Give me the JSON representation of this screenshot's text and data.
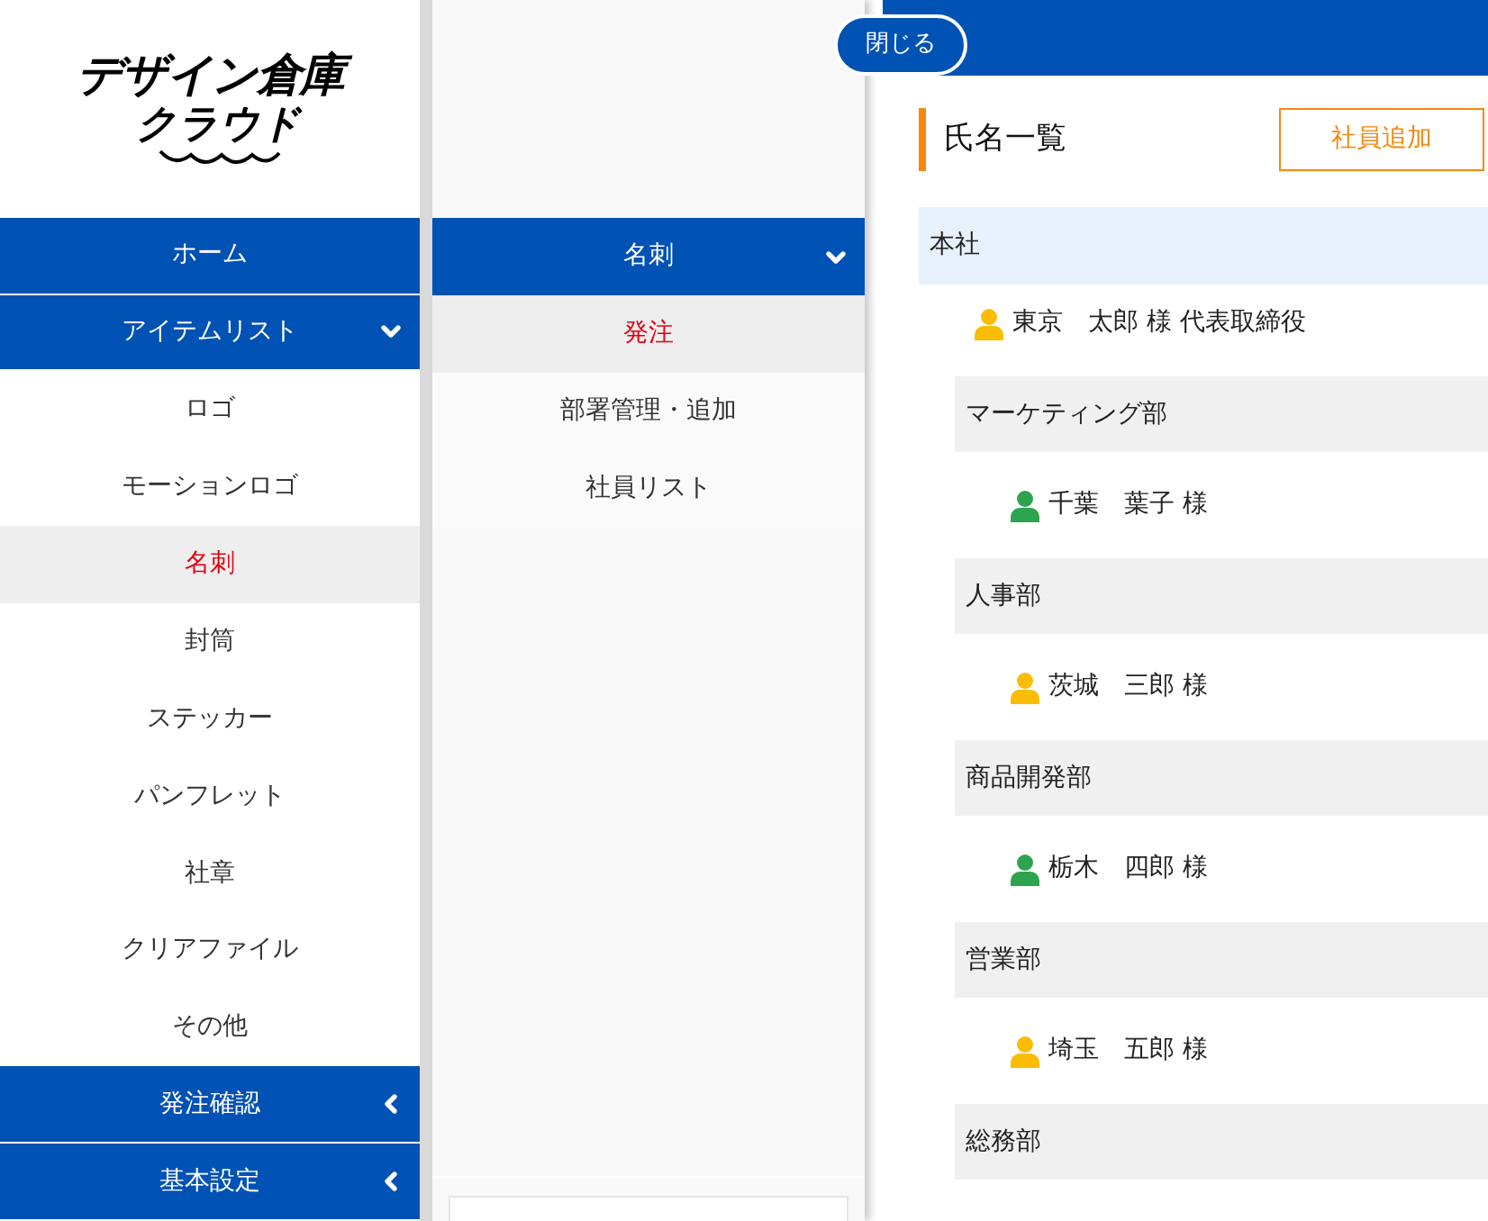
{
  "logo": {
    "line_1": "デザイン倉庫",
    "line_2": "クラウド"
  },
  "sidebar": {
    "items": [
      {
        "kind": "header",
        "label": "ホーム",
        "selected": false
      },
      {
        "kind": "header",
        "label": "アイテムリスト",
        "expanded": true,
        "selected": false
      },
      {
        "kind": "item",
        "label": "ロゴ",
        "selected": false
      },
      {
        "kind": "item",
        "label": "モーションロゴ",
        "selected": false
      },
      {
        "kind": "item",
        "label": "名刺",
        "selected": true
      },
      {
        "kind": "item",
        "label": "封筒",
        "selected": false
      },
      {
        "kind": "item",
        "label": "ステッカー",
        "selected": false
      },
      {
        "kind": "item",
        "label": "パンフレット",
        "selected": false
      },
      {
        "kind": "item",
        "label": "社章",
        "selected": false
      },
      {
        "kind": "item",
        "label": "クリアファイル",
        "selected": false
      },
      {
        "kind": "item",
        "label": "その他",
        "selected": false
      },
      {
        "kind": "header",
        "label": "発注確認",
        "expanded": false,
        "selected": false
      },
      {
        "kind": "header",
        "label": "基本設定",
        "expanded": false,
        "selected": false
      }
    ]
  },
  "submenu": {
    "title": "名刺",
    "expanded": true,
    "items": [
      {
        "label": "発注",
        "selected": true
      },
      {
        "label": "部署管理・追加",
        "selected": false
      },
      {
        "label": "社員リスト",
        "selected": false
      }
    ]
  },
  "close_bubble": "閉じる",
  "main": {
    "title": "氏名一覧",
    "add_button": "社員追加",
    "tree": [
      {
        "kind": "root",
        "label": "本社",
        "children": [
          {
            "kind": "person",
            "label": "東京　太郎 様 代表取締役",
            "color": "#fbbc05"
          },
          {
            "kind": "group",
            "label": "マーケティング部",
            "children": [
              {
                "kind": "person",
                "label": "千葉　葉子 様",
                "color": "#2ea44f"
              }
            ]
          },
          {
            "kind": "group",
            "label": "人事部",
            "children": [
              {
                "kind": "person",
                "label": "茨城　三郎 様",
                "color": "#fbbc05"
              }
            ]
          },
          {
            "kind": "group",
            "label": "商品開発部",
            "children": [
              {
                "kind": "person",
                "label": "栃木　四郎 様",
                "color": "#2ea44f"
              }
            ]
          },
          {
            "kind": "group",
            "label": "営業部",
            "children": [
              {
                "kind": "person",
                "label": "埼玉　五郎 様",
                "color": "#fbbc05"
              }
            ]
          },
          {
            "kind": "group",
            "label": "総務部"
          }
        ]
      }
    ]
  }
}
